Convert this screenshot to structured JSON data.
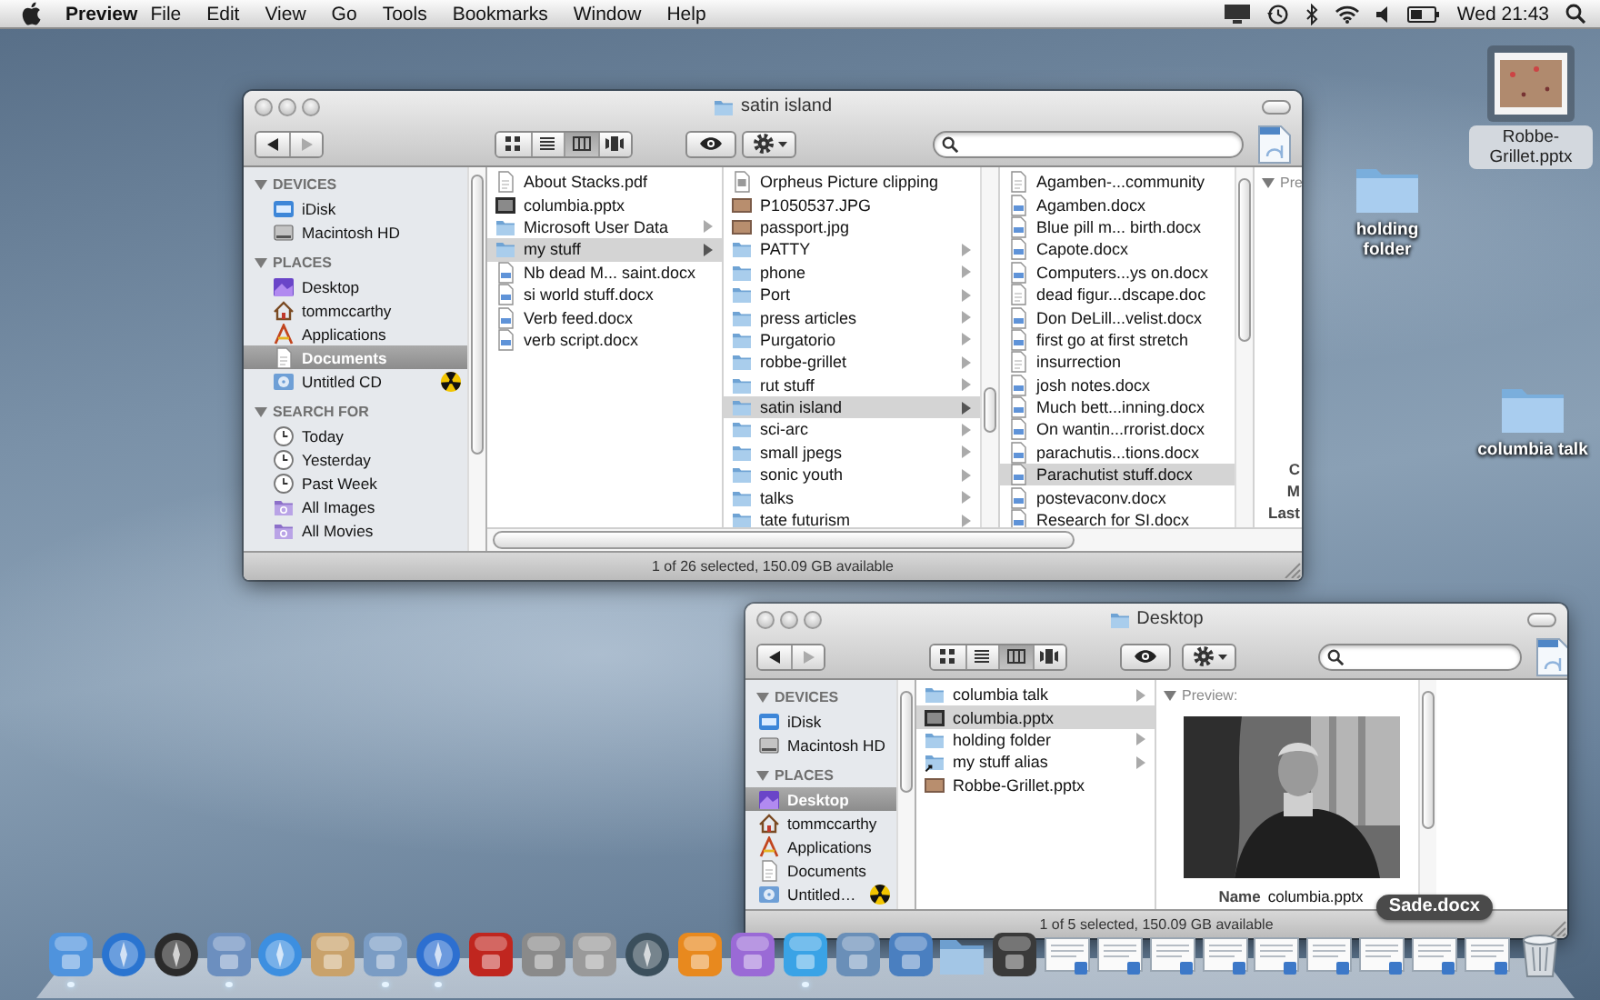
{
  "menu_bar": {
    "app_name": "Preview",
    "menus": [
      "File",
      "Edit",
      "View",
      "Go",
      "Tools",
      "Bookmarks",
      "Window",
      "Help"
    ],
    "clock": "Wed 21:43"
  },
  "desktop_items": [
    {
      "label": "Robbe-Grillet.pptx",
      "kind": "slide",
      "selected": true
    },
    {
      "label": "holding folder",
      "kind": "folder",
      "selected": false
    },
    {
      "label": "columbia talk",
      "kind": "folder",
      "selected": false
    }
  ],
  "windows": [
    {
      "title": "satin island",
      "navigation": {
        "back_enabled": true,
        "forward_enabled": false
      },
      "view_modes": [
        {
          "kind": "icon",
          "selected": false
        },
        {
          "kind": "list",
          "selected": false
        },
        {
          "kind": "column",
          "selected": true
        },
        {
          "kind": "coverflow",
          "selected": false
        }
      ],
      "sidebar": [
        {
          "heading": "DEVICES",
          "expanded": true,
          "items": [
            {
              "label": "iDisk",
              "kind": "idisk",
              "selected": false,
              "burnable": false
            },
            {
              "label": "Macintosh HD",
              "kind": "hd",
              "selected": false,
              "burnable": false
            }
          ]
        },
        {
          "heading": "PLACES",
          "expanded": true,
          "items": [
            {
              "label": "Desktop",
              "kind": "desktop",
              "selected": false,
              "burnable": false
            },
            {
              "label": "tommccarthy",
              "kind": "home",
              "selected": false,
              "burnable": false
            },
            {
              "label": "Applications",
              "kind": "apps",
              "selected": false,
              "burnable": false
            },
            {
              "label": "Documents",
              "kind": "documents",
              "selected": true,
              "burnable": false
            },
            {
              "label": "Untitled CD",
              "kind": "cd",
              "selected": false,
              "burnable": true
            }
          ]
        },
        {
          "heading": "SEARCH FOR",
          "expanded": true,
          "items": [
            {
              "label": "Today",
              "kind": "clock",
              "selected": false,
              "burnable": false
            },
            {
              "label": "Yesterday",
              "kind": "clock",
              "selected": false,
              "burnable": false
            },
            {
              "label": "Past Week",
              "kind": "clock",
              "selected": false,
              "burnable": false
            },
            {
              "label": "All Images",
              "kind": "smart",
              "selected": false,
              "burnable": false
            },
            {
              "label": "All Movies",
              "kind": "smart",
              "selected": false,
              "burnable": false
            }
          ]
        }
      ],
      "columns": [
        {
          "items": [
            {
              "name": "About Stacks.pdf",
              "kind": "document",
              "selected": false,
              "has_children": false
            },
            {
              "name": "columbia.pptx",
              "kind": "slide",
              "selected": false,
              "has_children": false
            },
            {
              "name": "Microsoft User Data",
              "kind": "folder",
              "selected": false,
              "has_children": true
            },
            {
              "name": "my stuff",
              "kind": "folder",
              "selected": true,
              "has_children": true
            },
            {
              "name": "Nb dead M... saint.docx",
              "kind": "docx",
              "selected": false,
              "has_children": false
            },
            {
              "name": "si world stuff.docx",
              "kind": "docx",
              "selected": false,
              "has_children": false
            },
            {
              "name": "Verb feed.docx",
              "kind": "docx",
              "selected": false,
              "has_children": false
            },
            {
              "name": "verb script.docx",
              "kind": "docx",
              "selected": false,
              "has_children": false
            }
          ]
        },
        {
          "items": [
            {
              "name": "Orpheus Picture clipping",
              "kind": "clipping",
              "selected": false,
              "has_children": false
            },
            {
              "name": "P1050537.JPG",
              "selected": false,
              "has_children": false
            },
            {
              "name": "passport.jpg",
              "selected": false,
              "has_children": false
            },
            {
              "name": "PATTY",
              "kind": "folder",
              "selected": false,
              "has_children": true
            },
            {
              "name": "phone",
              "kind": "folder",
              "selected": false,
              "has_children": true
            },
            {
              "name": "Port",
              "kind": "folder",
              "selected": false,
              "has_children": true
            },
            {
              "name": "press articles",
              "kind": "folder",
              "selected": false,
              "has_children": true
            },
            {
              "name": "Purgatorio",
              "kind": "folder",
              "selected": false,
              "has_children": true
            },
            {
              "name": "robbe-grillet",
              "kind": "folder",
              "selected": false,
              "has_children": true
            },
            {
              "name": "rut stuff",
              "kind": "folder",
              "selected": false,
              "has_children": true
            },
            {
              "name": "satin island",
              "kind": "folder",
              "selected": true,
              "has_children": true
            },
            {
              "name": "sci-arc",
              "kind": "folder",
              "selected": false,
              "has_children": true
            },
            {
              "name": "small jpegs",
              "kind": "folder",
              "selected": false,
              "has_children": true
            },
            {
              "name": "sonic youth",
              "kind": "folder",
              "selected": false,
              "has_children": true
            },
            {
              "name": "talks",
              "kind": "folder",
              "selected": false,
              "has_children": true
            },
            {
              "name": "tate futurism",
              "kind": "folder",
              "selected": false,
              "has_children": true
            }
          ]
        },
        {
          "items": [
            {
              "name": "Agamben-...community",
              "kind": "document",
              "selected": false,
              "has_children": false
            },
            {
              "name": "Agamben.docx",
              "kind": "docx",
              "selected": false,
              "has_children": false
            },
            {
              "name": "Blue pill m... birth.docx",
              "kind": "docx",
              "selected": false,
              "has_children": false
            },
            {
              "name": "Capote.docx",
              "kind": "docx",
              "selected": false,
              "has_children": false
            },
            {
              "name": "Computers...ys on.docx",
              "kind": "docx",
              "selected": false,
              "has_children": false
            },
            {
              "name": "dead figur...dscape.doc",
              "kind": "document",
              "selected": false,
              "has_children": false
            },
            {
              "name": "Don DeLill...velist.docx",
              "kind": "docx",
              "selected": false,
              "has_children": false
            },
            {
              "name": "first go at first stretch",
              "kind": "docx",
              "selected": false,
              "has_children": false
            },
            {
              "name": "insurrection",
              "kind": "document",
              "selected": false,
              "has_children": false
            },
            {
              "name": "josh notes.docx",
              "kind": "docx",
              "selected": false,
              "has_children": false
            },
            {
              "name": "Much bett...inning.docx",
              "kind": "docx",
              "selected": false,
              "has_children": false
            },
            {
              "name": "On wantin...rrorist.docx",
              "kind": "docx",
              "selected": false,
              "has_children": false
            },
            {
              "name": "parachutis...tions.docx",
              "kind": "docx",
              "selected": false,
              "has_children": false
            },
            {
              "name": "Parachutist stuff.docx",
              "kind": "docx",
              "selected": true,
              "has_children": false
            },
            {
              "name": "postevaconv.docx",
              "kind": "docx",
              "selected": false,
              "has_children": false
            },
            {
              "name": "Research for SI.docx",
              "kind": "docx",
              "selected": false,
              "has_children": false
            }
          ]
        }
      ],
      "preview": {
        "heading": "Pre",
        "fields": [
          {
            "label": "C"
          },
          {
            "label": "M"
          },
          {
            "label": "Last"
          }
        ]
      },
      "status": "1 of 26 selected, 150.09 GB available"
    },
    {
      "title": "Desktop",
      "navigation": {
        "back_enabled": true,
        "forward_enabled": false
      },
      "view_modes": [
        {
          "kind": "icon",
          "selected": false
        },
        {
          "kind": "list",
          "selected": false
        },
        {
          "kind": "column",
          "selected": true
        },
        {
          "kind": "coverflow",
          "selected": false
        }
      ],
      "sidebar": [
        {
          "heading": "DEVICES",
          "expanded": true,
          "items": [
            {
              "label": "iDisk",
              "kind": "idisk",
              "selected": false,
              "burnable": false
            },
            {
              "label": "Macintosh HD",
              "kind": "hd",
              "selected": false,
              "burnable": false
            }
          ]
        },
        {
          "heading": "PLACES",
          "expanded": true,
          "items": [
            {
              "label": "Desktop",
              "kind": "desktop",
              "selected": true,
              "burnable": false
            },
            {
              "label": "tommccarthy",
              "kind": "home",
              "selected": false,
              "burnable": false
            },
            {
              "label": "Applications",
              "kind": "apps",
              "selected": false,
              "burnable": false
            },
            {
              "label": "Documents",
              "kind": "documents",
              "selected": false,
              "burnable": false
            },
            {
              "label": "Untitled…",
              "kind": "cd",
              "selected": false,
              "burnable": true
            }
          ]
        }
      ],
      "columns": [
        {
          "items": [
            {
              "name": "columbia talk",
              "kind": "folder",
              "selected": false,
              "has_children": true
            },
            {
              "name": "columbia.pptx",
              "kind": "slide",
              "selected": true,
              "has_children": false
            },
            {
              "name": "holding folder",
              "kind": "folder",
              "selected": false,
              "has_children": true
            },
            {
              "name": "my stuff alias",
              "kind": "alias",
              "selected": false,
              "has_children": true
            },
            {
              "name": "Robbe-Grillet.pptx",
              "selected": false,
              "has_children": false
            }
          ]
        }
      ],
      "preview": {
        "heading": "Preview:",
        "fields": [
          {
            "label": "Name",
            "value": "columbia.pptx"
          }
        ]
      },
      "status": "1 of 5 selected, 150.09 GB available"
    }
  ],
  "dock": {
    "items": [
      {
        "kind": "app",
        "color": "#4f93dd",
        "running": true
      },
      {
        "kind": "round-app",
        "color": "#2a74d0",
        "running": false
      },
      {
        "kind": "round-app",
        "color": "#2b2b2b",
        "running": false
      },
      {
        "kind": "app",
        "color": "#6c8fbf",
        "running": true
      },
      {
        "kind": "round-app",
        "color": "#3d8fe0",
        "running": false
      },
      {
        "kind": "app",
        "color": "#c9a26b",
        "running": false
      },
      {
        "kind": "app",
        "color": "#7a9cc4",
        "running": true
      },
      {
        "kind": "round-app",
        "color": "#2d6fd0",
        "running": true
      },
      {
        "kind": "app",
        "color": "#c0261f",
        "running": false
      },
      {
        "kind": "app",
        "color": "#8a8a8a",
        "running": false
      },
      {
        "kind": "app",
        "color": "#9a9a9a",
        "running": false
      },
      {
        "kind": "round-app",
        "color": "#3b4f5c",
        "running": false
      },
      {
        "kind": "app",
        "color": "#e8891e",
        "running": false
      },
      {
        "kind": "app",
        "color": "#9a6ad6",
        "running": false
      },
      {
        "kind": "app",
        "color": "#3aa3e6",
        "running": true
      },
      {
        "kind": "app",
        "color": "#6a8fb8",
        "running": false
      },
      {
        "kind": "app",
        "color": "#4a7fc0",
        "running": false
      },
      {
        "kind": "folder",
        "running": false
      },
      {
        "kind": "app",
        "color": "#3a3a3a",
        "running": false
      },
      {
        "kind": "document",
        "running": false
      },
      {
        "kind": "document",
        "running": false
      },
      {
        "kind": "document",
        "running": false
      },
      {
        "kind": "document",
        "running": false
      },
      {
        "kind": "document",
        "running": false
      },
      {
        "kind": "document",
        "running": false
      },
      {
        "kind": "document",
        "running": false
      },
      {
        "kind": "document",
        "running": false,
        "tooltip": "Sade.docx"
      },
      {
        "kind": "document",
        "running": false
      },
      {
        "kind": "trash",
        "running": false
      }
    ]
  }
}
